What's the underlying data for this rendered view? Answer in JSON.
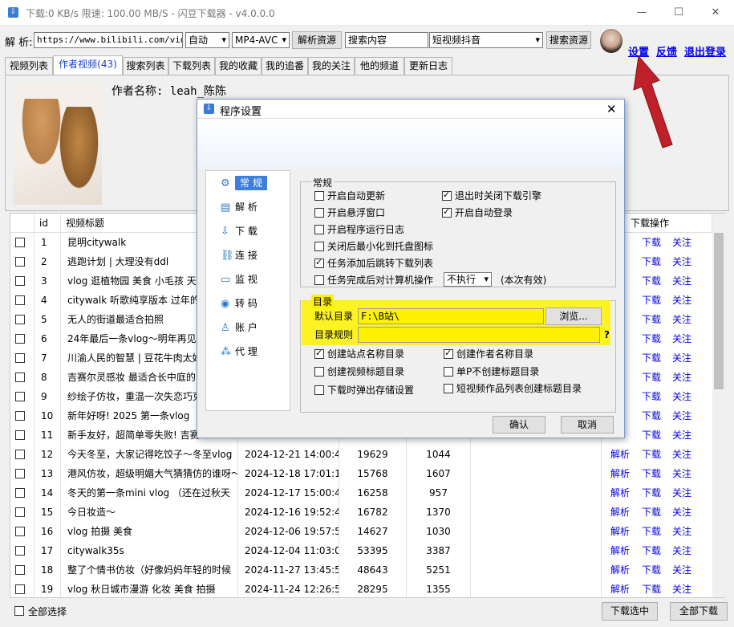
{
  "window": {
    "title": "下载:0 KB/s  限速: 100.00 MB/S  - 闪豆下载器 - v4.0.0.0",
    "controls": [
      "—",
      "☐",
      "✕"
    ]
  },
  "toolbar": {
    "parse_label": "解 析:",
    "url_value": "https://www.bilibili.com/video",
    "mode_value": "自动",
    "format_value": "MP4-AVC",
    "parse_button": "解析资源",
    "search_value": "搜索内容",
    "platform_value": "短视频抖音",
    "search_button": "搜索资源",
    "settings_link": "设置",
    "feedback_link": "反馈",
    "logout_link": "退出登录"
  },
  "tabs": [
    "视频列表",
    "作者视频(43)",
    "搜索列表",
    "下载列表",
    "我的收藏",
    "我的追番",
    "我的关注",
    "他的频道",
    "更新日志"
  ],
  "author": {
    "label": "作者名称: leah_陈陈"
  },
  "table": {
    "headers": {
      "id": "id",
      "title": "视频标题",
      "download": "下载操作"
    },
    "rows": [
      {
        "id": "1",
        "title": "昆明citywalk",
        "date": "",
        "views": "",
        "likes": "",
        "a1": "",
        "a2": "下载",
        "a3": "关注"
      },
      {
        "id": "2",
        "title": "逃跑计划 | 大理没有ddl",
        "date": "",
        "views": "",
        "likes": "",
        "a1": "",
        "a2": "下载",
        "a3": "关注"
      },
      {
        "id": "3",
        "title": "vlog 逛植物园 美食 小毛孩 天",
        "date": "",
        "views": "",
        "likes": "",
        "a1": "",
        "a2": "下载",
        "a3": "关注"
      },
      {
        "id": "4",
        "title": "citywalk 听歌纯享版本 过年的",
        "date": "",
        "views": "",
        "likes": "",
        "a1": "",
        "a2": "下载",
        "a3": "关注"
      },
      {
        "id": "5",
        "title": "无人的街道最适合拍照",
        "date": "",
        "views": "",
        "likes": "",
        "a1": "",
        "a2": "下载",
        "a3": "关注"
      },
      {
        "id": "6",
        "title": "24年最后一条vlog～明年再见",
        "date": "",
        "views": "",
        "likes": "",
        "a1": "",
        "a2": "下载",
        "a3": "关注"
      },
      {
        "id": "7",
        "title": "川渝人民的智慧 | 豆花牛肉太好",
        "date": "",
        "views": "",
        "likes": "",
        "a1": "",
        "a2": "下载",
        "a3": "关注"
      },
      {
        "id": "8",
        "title": "吉赛尔灵感妆 最适合长中庭的",
        "date": "",
        "views": "",
        "likes": "",
        "a1": "",
        "a2": "下载",
        "a3": "关注"
      },
      {
        "id": "9",
        "title": "纱绘子仿妆，重温一次失恋巧克",
        "date": "",
        "views": "",
        "likes": "",
        "a1": "",
        "a2": "下载",
        "a3": "关注"
      },
      {
        "id": "10",
        "title": "新年好呀! 2025 第一条vlog",
        "date": "",
        "views": "",
        "likes": "",
        "a1": "",
        "a2": "下载",
        "a3": "关注"
      },
      {
        "id": "11",
        "title": "新手友好，超简单零失败! 吉赛",
        "date": "",
        "views": "",
        "likes": "",
        "a1": "",
        "a2": "下载",
        "a3": "关注"
      },
      {
        "id": "12",
        "title": "今天冬至，大家记得吃饺子～冬至vlog",
        "date": "2024-12-21 14:00:42",
        "views": "19629",
        "likes": "1044",
        "a1": "解析",
        "a2": "下载",
        "a3": "关注"
      },
      {
        "id": "13",
        "title": "港风仿妆，超级明媚大气猜猜仿的谁呀～",
        "date": "2024-12-18 17:01:12",
        "views": "15768",
        "likes": "1607",
        "a1": "解析",
        "a2": "下载",
        "a3": "关注"
      },
      {
        "id": "14",
        "title": "冬天的第一条mini vlog （还在过秋天",
        "date": "2024-12-17 15:00:42",
        "views": "16258",
        "likes": "957",
        "a1": "解析",
        "a2": "下载",
        "a3": "关注"
      },
      {
        "id": "15",
        "title": "今日妆造～",
        "date": "2024-12-16 19:52:44",
        "views": "16782",
        "likes": "1370",
        "a1": "解析",
        "a2": "下载",
        "a3": "关注"
      },
      {
        "id": "16",
        "title": "vlog 拍摄 美食",
        "date": "2024-12-06 19:57:52",
        "views": "14627",
        "likes": "1030",
        "a1": "解析",
        "a2": "下载",
        "a3": "关注"
      },
      {
        "id": "17",
        "title": "citywalk35s",
        "date": "2024-12-04 11:03:08",
        "views": "53395",
        "likes": "3387",
        "a1": "解析",
        "a2": "下载",
        "a3": "关注"
      },
      {
        "id": "18",
        "title": "整了个情书仿妆（好像妈妈年轻的时候",
        "date": "2024-11-27 13:45:51",
        "views": "48643",
        "likes": "5251",
        "a1": "解析",
        "a2": "下载",
        "a3": "关注"
      },
      {
        "id": "19",
        "title": "vlog 秋日城市漫游 化妆 美食 拍摄",
        "date": "2024-11-24 12:26:58",
        "views": "28295",
        "likes": "1355",
        "a1": "解析",
        "a2": "下载",
        "a3": "关注"
      }
    ]
  },
  "bottom": {
    "select_all": "全部选择",
    "download_selected": "下载选中",
    "download_all": "全部下载"
  },
  "dialog": {
    "title": "程序设置",
    "nav": [
      "常 规",
      "解 析",
      "下 载",
      "连 接",
      "监 视",
      "转 码",
      "账 户",
      "代 理"
    ],
    "nav_icons": [
      "settings-icon",
      "parse-icon",
      "download-icon",
      "link-icon",
      "monitor-icon",
      "transcode-icon",
      "user-icon",
      "proxy-icon"
    ],
    "general": {
      "title": "常规",
      "options_left": [
        {
          "label": "开启自动更新",
          "checked": false
        },
        {
          "label": "开启悬浮窗口",
          "checked": false
        },
        {
          "label": "开启程序运行日志",
          "checked": false
        },
        {
          "label": "关闭后最小化到托盘图标",
          "checked": false
        },
        {
          "label": "任务添加后跳转下载列表",
          "checked": true
        },
        {
          "label": "任务完成后对计算机操作",
          "checked": false
        }
      ],
      "options_right": [
        {
          "label": "退出时关闭下载引擎",
          "checked": true
        },
        {
          "label": "开启自动登录",
          "checked": true
        }
      ],
      "action_value": "不执行",
      "action_note": "(本次有效)"
    },
    "directory": {
      "title": "目录",
      "default_label": "默认目录",
      "default_value": "F:\\B站\\",
      "browse_button": "浏览...",
      "rule_label": "目录规则",
      "rule_value": "",
      "help": "?",
      "options": [
        {
          "label": "创建站点名称目录",
          "checked": true
        },
        {
          "label": "创建作者名称目录",
          "checked": true
        },
        {
          "label": "创建视频标题目录",
          "checked": false
        },
        {
          "label": "单P不创建标题目录",
          "checked": false
        },
        {
          "label": "下载时弹出存储设置",
          "checked": false
        },
        {
          "label": "短视频作品列表创建标题目录",
          "checked": false
        }
      ]
    },
    "ok_button": "确认",
    "cancel_button": "取消"
  },
  "colors": {
    "accent": "#3d7ee0",
    "link": "#0000ee",
    "highlight": "#fff200",
    "arrow": "#c0202a"
  }
}
